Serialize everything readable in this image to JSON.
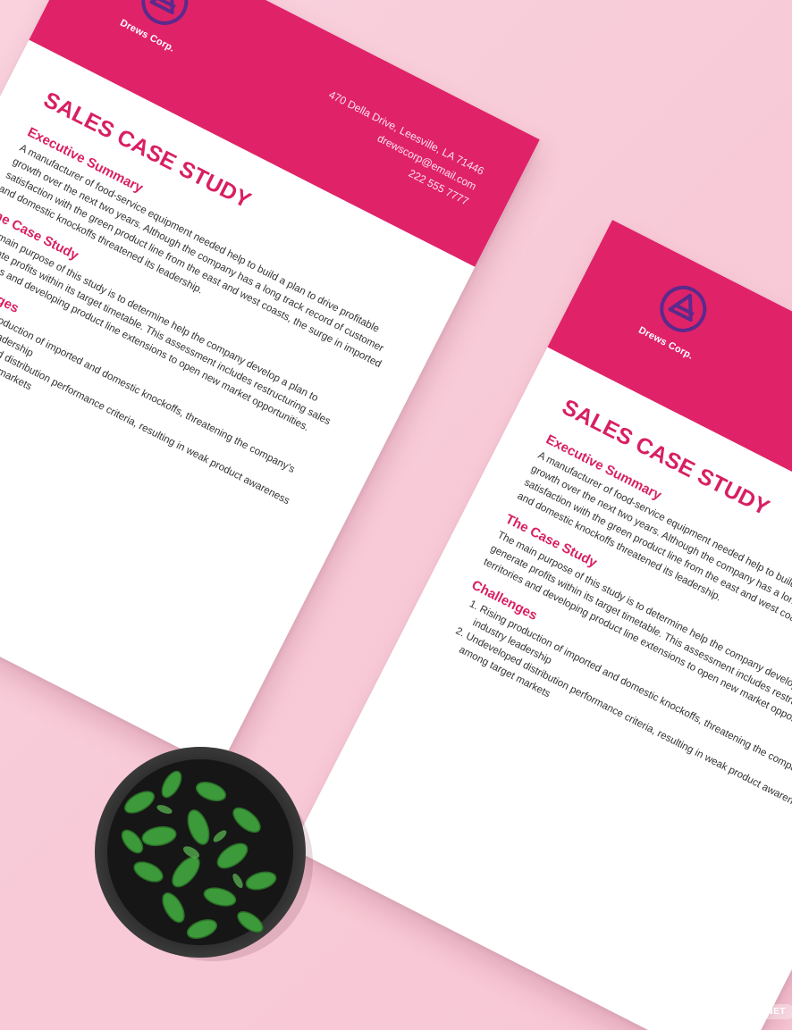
{
  "brand": {
    "name": "Drews Corp.",
    "accent_color": "#e02268",
    "logo_color": "#5a2a8c"
  },
  "contact": {
    "address": "470 Della Drive, Leesville, LA 71446",
    "email": "drewscorp@email.com",
    "phone": "222 555 7777"
  },
  "document": {
    "title": "SALES CASE STUDY",
    "sections": {
      "executive_summary": {
        "heading": "Executive Summary",
        "body": "A manufacturer of food-service equipment needed help to build a plan to drive profitable growth over the next two years. Although the company has a long track record of customer satisfaction with the green product line from the east and west coasts, the surge in imported and domestic knockoffs threatened its leadership."
      },
      "case_study": {
        "heading": "The Case Study",
        "body": "The main purpose of this study is to determine help the company develop a plan to generate profits within its target timetable. This assessment includes restructuring sales territories and developing product line extensions to open new market opportunities."
      },
      "challenges": {
        "heading": "Challenges",
        "items": [
          "Rising production of imported and domestic knockoffs, threatening the company's industry leadership",
          "Undeveloped distribution performance criteria, resulting in weak product awareness among target markets"
        ]
      }
    }
  },
  "watermark": "TEMPLATE.NET"
}
